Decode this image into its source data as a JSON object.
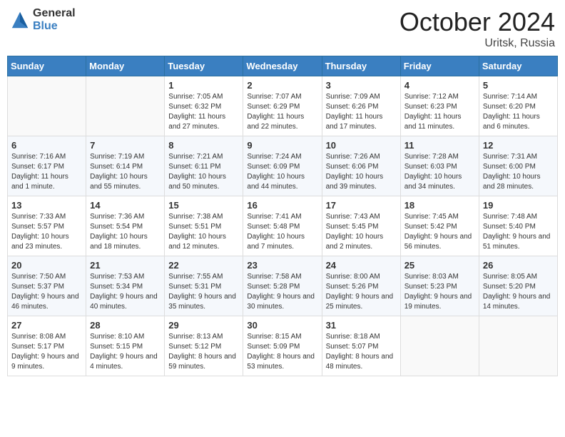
{
  "header": {
    "logo_general": "General",
    "logo_blue": "Blue",
    "month_title": "October 2024",
    "location": "Uritsk, Russia"
  },
  "weekdays": [
    "Sunday",
    "Monday",
    "Tuesday",
    "Wednesday",
    "Thursday",
    "Friday",
    "Saturday"
  ],
  "weeks": [
    [
      {
        "day": "",
        "info": ""
      },
      {
        "day": "",
        "info": ""
      },
      {
        "day": "1",
        "info": "Sunrise: 7:05 AM\nSunset: 6:32 PM\nDaylight: 11 hours and 27 minutes."
      },
      {
        "day": "2",
        "info": "Sunrise: 7:07 AM\nSunset: 6:29 PM\nDaylight: 11 hours and 22 minutes."
      },
      {
        "day": "3",
        "info": "Sunrise: 7:09 AM\nSunset: 6:26 PM\nDaylight: 11 hours and 17 minutes."
      },
      {
        "day": "4",
        "info": "Sunrise: 7:12 AM\nSunset: 6:23 PM\nDaylight: 11 hours and 11 minutes."
      },
      {
        "day": "5",
        "info": "Sunrise: 7:14 AM\nSunset: 6:20 PM\nDaylight: 11 hours and 6 minutes."
      }
    ],
    [
      {
        "day": "6",
        "info": "Sunrise: 7:16 AM\nSunset: 6:17 PM\nDaylight: 11 hours and 1 minute."
      },
      {
        "day": "7",
        "info": "Sunrise: 7:19 AM\nSunset: 6:14 PM\nDaylight: 10 hours and 55 minutes."
      },
      {
        "day": "8",
        "info": "Sunrise: 7:21 AM\nSunset: 6:11 PM\nDaylight: 10 hours and 50 minutes."
      },
      {
        "day": "9",
        "info": "Sunrise: 7:24 AM\nSunset: 6:09 PM\nDaylight: 10 hours and 44 minutes."
      },
      {
        "day": "10",
        "info": "Sunrise: 7:26 AM\nSunset: 6:06 PM\nDaylight: 10 hours and 39 minutes."
      },
      {
        "day": "11",
        "info": "Sunrise: 7:28 AM\nSunset: 6:03 PM\nDaylight: 10 hours and 34 minutes."
      },
      {
        "day": "12",
        "info": "Sunrise: 7:31 AM\nSunset: 6:00 PM\nDaylight: 10 hours and 28 minutes."
      }
    ],
    [
      {
        "day": "13",
        "info": "Sunrise: 7:33 AM\nSunset: 5:57 PM\nDaylight: 10 hours and 23 minutes."
      },
      {
        "day": "14",
        "info": "Sunrise: 7:36 AM\nSunset: 5:54 PM\nDaylight: 10 hours and 18 minutes."
      },
      {
        "day": "15",
        "info": "Sunrise: 7:38 AM\nSunset: 5:51 PM\nDaylight: 10 hours and 12 minutes."
      },
      {
        "day": "16",
        "info": "Sunrise: 7:41 AM\nSunset: 5:48 PM\nDaylight: 10 hours and 7 minutes."
      },
      {
        "day": "17",
        "info": "Sunrise: 7:43 AM\nSunset: 5:45 PM\nDaylight: 10 hours and 2 minutes."
      },
      {
        "day": "18",
        "info": "Sunrise: 7:45 AM\nSunset: 5:42 PM\nDaylight: 9 hours and 56 minutes."
      },
      {
        "day": "19",
        "info": "Sunrise: 7:48 AM\nSunset: 5:40 PM\nDaylight: 9 hours and 51 minutes."
      }
    ],
    [
      {
        "day": "20",
        "info": "Sunrise: 7:50 AM\nSunset: 5:37 PM\nDaylight: 9 hours and 46 minutes."
      },
      {
        "day": "21",
        "info": "Sunrise: 7:53 AM\nSunset: 5:34 PM\nDaylight: 9 hours and 40 minutes."
      },
      {
        "day": "22",
        "info": "Sunrise: 7:55 AM\nSunset: 5:31 PM\nDaylight: 9 hours and 35 minutes."
      },
      {
        "day": "23",
        "info": "Sunrise: 7:58 AM\nSunset: 5:28 PM\nDaylight: 9 hours and 30 minutes."
      },
      {
        "day": "24",
        "info": "Sunrise: 8:00 AM\nSunset: 5:26 PM\nDaylight: 9 hours and 25 minutes."
      },
      {
        "day": "25",
        "info": "Sunrise: 8:03 AM\nSunset: 5:23 PM\nDaylight: 9 hours and 19 minutes."
      },
      {
        "day": "26",
        "info": "Sunrise: 8:05 AM\nSunset: 5:20 PM\nDaylight: 9 hours and 14 minutes."
      }
    ],
    [
      {
        "day": "27",
        "info": "Sunrise: 8:08 AM\nSunset: 5:17 PM\nDaylight: 9 hours and 9 minutes."
      },
      {
        "day": "28",
        "info": "Sunrise: 8:10 AM\nSunset: 5:15 PM\nDaylight: 9 hours and 4 minutes."
      },
      {
        "day": "29",
        "info": "Sunrise: 8:13 AM\nSunset: 5:12 PM\nDaylight: 8 hours and 59 minutes."
      },
      {
        "day": "30",
        "info": "Sunrise: 8:15 AM\nSunset: 5:09 PM\nDaylight: 8 hours and 53 minutes."
      },
      {
        "day": "31",
        "info": "Sunrise: 8:18 AM\nSunset: 5:07 PM\nDaylight: 8 hours and 48 minutes."
      },
      {
        "day": "",
        "info": ""
      },
      {
        "day": "",
        "info": ""
      }
    ]
  ]
}
